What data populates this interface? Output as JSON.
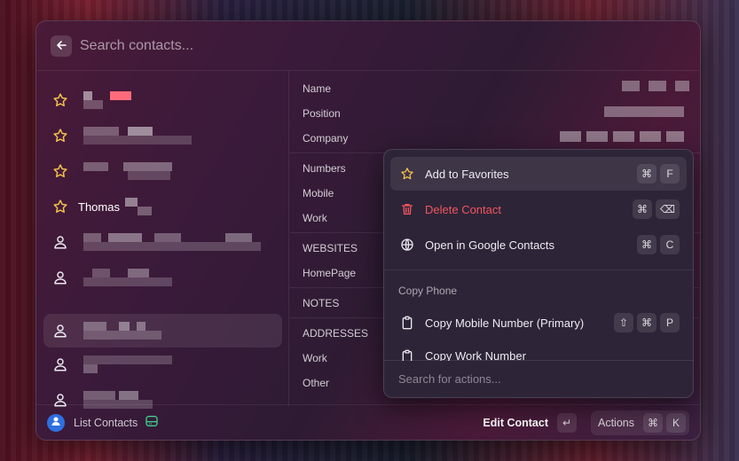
{
  "search": {
    "placeholder": "Search contacts..."
  },
  "contacts": [
    {
      "icon": "star",
      "name": "",
      "favorite": true
    },
    {
      "icon": "star",
      "name": "",
      "favorite": true
    },
    {
      "icon": "star",
      "name": "",
      "favorite": true
    },
    {
      "icon": "star",
      "name": "Thomas",
      "favorite": true
    },
    {
      "icon": "person",
      "name": "",
      "favorite": false
    },
    {
      "icon": "person",
      "name": "",
      "favorite": false
    },
    {
      "icon": "person",
      "name": "",
      "favorite": false,
      "selected": true
    },
    {
      "icon": "person",
      "name": "",
      "favorite": false
    },
    {
      "icon": "person",
      "name": "",
      "favorite": false
    }
  ],
  "detail": {
    "name_label": "Name",
    "position_label": "Position",
    "company_label": "Company",
    "numbers_label": "Numbers",
    "mobile_label": "Mobile",
    "work_label": "Work",
    "websites_label": "WEBSITES",
    "homepage_label": "HomePage",
    "notes_label": "NOTES",
    "addresses_label": "ADDRESSES",
    "addr_work_label": "Work",
    "addr_other_label": "Other"
  },
  "footer": {
    "list_contacts": "List Contacts",
    "edit_contact": "Edit Contact",
    "edit_key": "↵",
    "actions": "Actions",
    "actions_key1": "⌘",
    "actions_key2": "K"
  },
  "popup": {
    "add_favorites": "Add to Favorites",
    "add_keys": [
      "⌘",
      "F"
    ],
    "delete_contact": "Delete Contact",
    "delete_keys": [
      "⌘",
      "⌫"
    ],
    "open_google": "Open in Google Contacts",
    "open_keys": [
      "⌘",
      "C"
    ],
    "copy_phone_header": "Copy Phone",
    "copy_mobile": "Copy Mobile Number (Primary)",
    "copy_mobile_keys": [
      "⇧",
      "⌘",
      "P"
    ],
    "copy_work": "Copy Work Number",
    "search_placeholder": "Search for actions..."
  },
  "colors": {
    "star": "#f2c14e",
    "delete": "#f0565c",
    "avatar": "#2f6fe0",
    "accent_green": "#3ecf8e"
  }
}
